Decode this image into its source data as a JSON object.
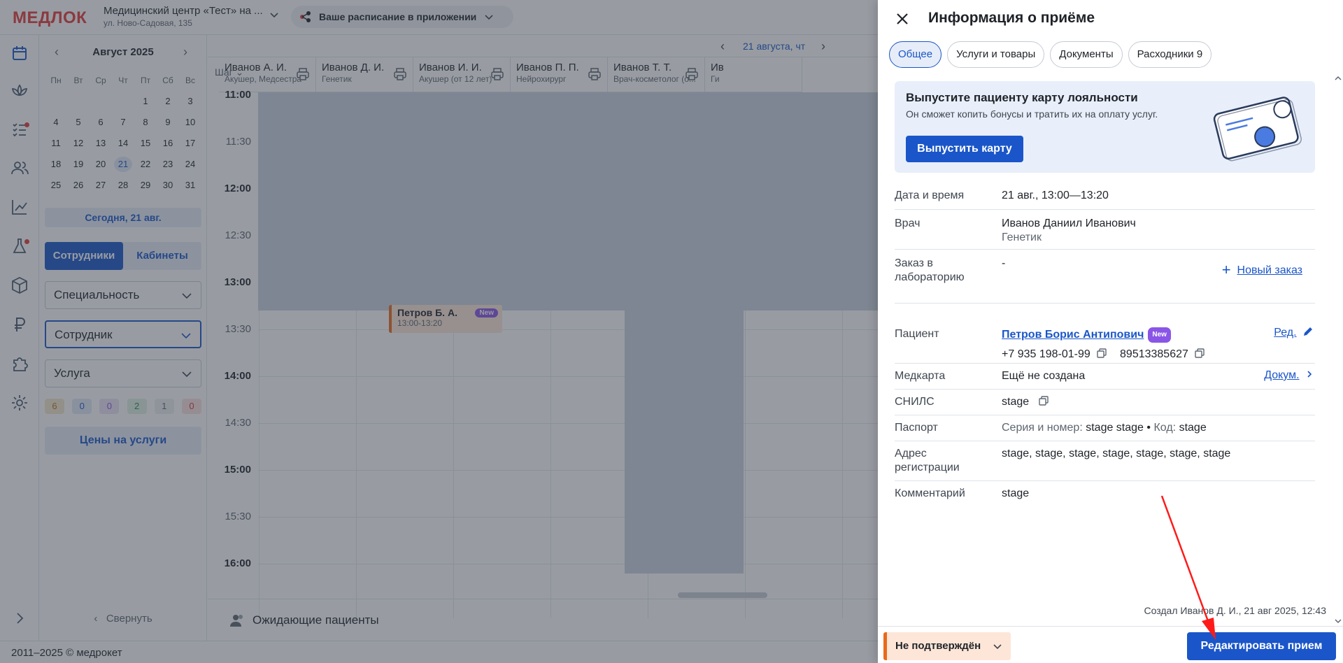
{
  "app": {
    "logo": "МЕДЛОК",
    "clinic_name": "Медицинский центр «Тест» на ...",
    "clinic_address": "ул. Ново-Садовая, 135",
    "promo_label": "Ваше расписание в приложении",
    "footer": "2011–2025 © медрокет"
  },
  "sidebar": {
    "month": "Август 2025",
    "weekdays": [
      "Пн",
      "Вт",
      "Ср",
      "Чт",
      "Пт",
      "Сб",
      "Вс"
    ],
    "days": [
      "",
      "",
      "",
      "",
      "1",
      "2",
      "3",
      "4",
      "5",
      "6",
      "7",
      "8",
      "9",
      "10",
      "11",
      "12",
      "13",
      "14",
      "15",
      "16",
      "17",
      "18",
      "19",
      "20",
      "21",
      "22",
      "23",
      "24",
      "25",
      "26",
      "27",
      "28",
      "29",
      "30",
      "31"
    ],
    "selected_day": "21",
    "today_button": "Сегодня, 21 авг.",
    "tab_staff": "Сотрудники",
    "tab_rooms": "Кабинеты",
    "filter_specialty": "Специальность",
    "filter_employee": "Сотрудник",
    "filter_service": "Услуга",
    "counters": [
      {
        "value": "6",
        "color": "#f5e6cc",
        "text": "#b8731a"
      },
      {
        "value": "0",
        "color": "#e0e8f7",
        "text": "#1a56c9"
      },
      {
        "value": "0",
        "color": "#ece3f7",
        "text": "#8a55e6"
      },
      {
        "value": "2",
        "color": "#dff1e3",
        "text": "#2c8a47"
      },
      {
        "value": "1",
        "color": "#eceef1",
        "text": "#5f6670"
      },
      {
        "value": "0",
        "color": "#fbe0e0",
        "text": "#d43a3a"
      }
    ],
    "prices_button": "Цены на услуги",
    "collapse": "Свернуть"
  },
  "schedule": {
    "date": "21 августа, чт",
    "step_label": "Шаг",
    "columns": [
      {
        "name": "Иванов А. И.",
        "spec": "Акушер, Медсестра"
      },
      {
        "name": "Иванов Д. И.",
        "spec": "Генетик"
      },
      {
        "name": "Иванов И. И.",
        "spec": "Акушер (от 12 лет)"
      },
      {
        "name": "Иванов П. П.",
        "spec": "Нейрохирург"
      },
      {
        "name": "Иванов Т. Т.",
        "spec": "Врач-косметолог (о..."
      },
      {
        "name": "Ив",
        "spec": "Ги"
      }
    ],
    "times": [
      "11:00",
      "11:30",
      "12:00",
      "12:30",
      "13:00",
      "13:30",
      "14:00",
      "14:30",
      "15:00",
      "15:30",
      "16:00"
    ],
    "appointment": {
      "name": "Петров Б. А.",
      "time": "13:00-13:20",
      "badge": "New"
    },
    "waiting": "Ожидающие пациенты"
  },
  "panel": {
    "title": "Информация о приёме",
    "tabs": [
      "Общее",
      "Услуги и товары",
      "Документы",
      "Расходники 9"
    ],
    "loyalty": {
      "title": "Выпустите пациенту карту лояльности",
      "subtitle": "Он сможет копить бонусы и тратить их на оплату услуг.",
      "button": "Выпустить карту"
    },
    "datetime_label": "Дата и время",
    "datetime_value": "21 авг., 13:00—13:20",
    "doctor_label": "Врач",
    "doctor_name": "Иванов Даниил Иванович",
    "doctor_spec": "Генетик",
    "lab_label": "Заказ в лабораторию",
    "lab_value": "-",
    "new_order": "Новый заказ",
    "patient_label": "Пациент",
    "patient_name": "Петров Борис Антипович",
    "patient_badge": "New",
    "edit_link": "Ред.",
    "phone1": "+7 935 198-01-99",
    "phone2": "89513385627",
    "medcard_label": "Медкарта",
    "medcard_value": "Ещё не создана",
    "docs_link": "Докум.",
    "snils_label": "СНИЛС",
    "snils_value": "stage",
    "passport_label": "Паспорт",
    "passport_series_label": "Серия и номер:",
    "passport_series_value": "stage stage",
    "passport_code_label": "Код:",
    "passport_code_value": "stage",
    "address_label": "Адрес регистрации",
    "address_value": "stage, stage, stage, stage, stage, stage, stage",
    "comment_label": "Комментарий",
    "comment_value": "stage",
    "created": "Создал Иванов Д. И., 21 авг 2025, 12:43",
    "status": "Не подтверждён",
    "edit_button": "Редактировать прием"
  }
}
